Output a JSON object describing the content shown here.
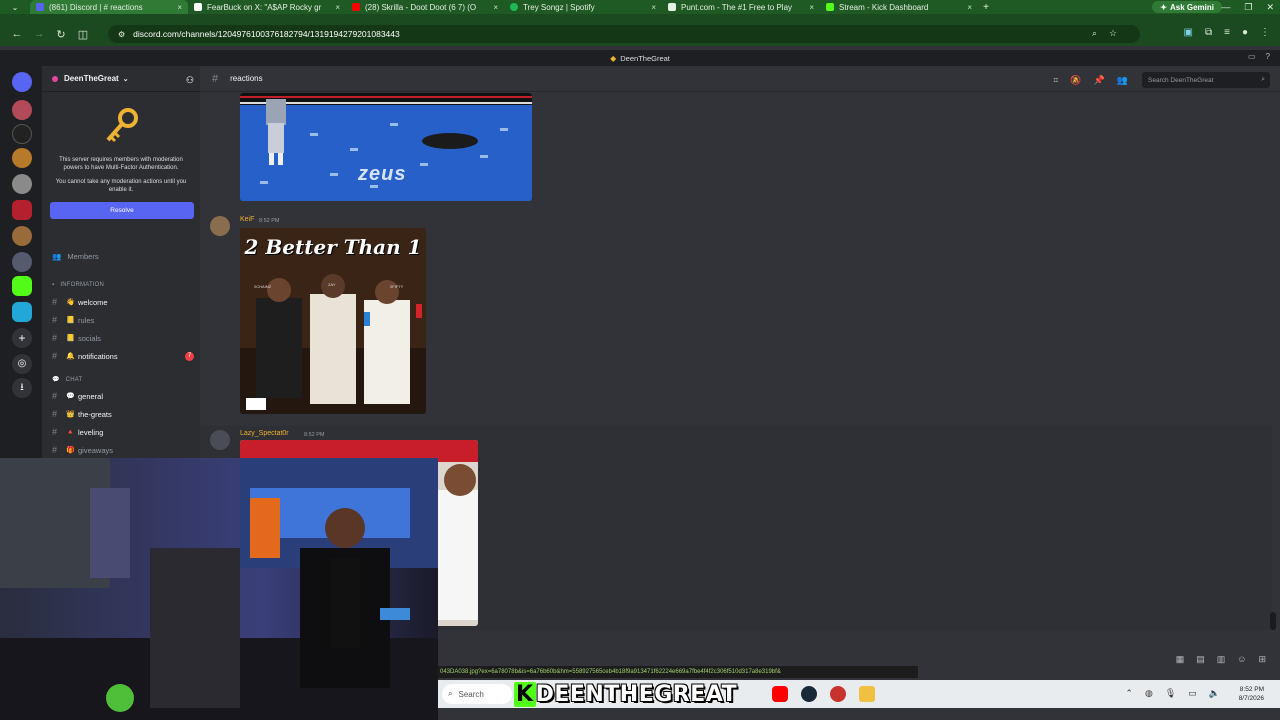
{
  "browser": {
    "tabs": [
      {
        "title": "(861) Discord | # reactions",
        "fav": "#5865f2",
        "active": true
      },
      {
        "title": "FearBuck on X: \"A$AP Rocky gr",
        "fav": "#ffffff",
        "active": false
      },
      {
        "title": "(28) Skrilla - Doot Doot (6 7) (O",
        "fav": "#ff0000",
        "active": false
      },
      {
        "title": "Trey Songz | Spotify",
        "fav": "#1db954",
        "active": false
      },
      {
        "title": "Punt.com - The #1 Free to Play",
        "fav": "#e6efe4",
        "active": false
      },
      {
        "title": "Stream - Kick Dashboard",
        "fav": "#53fc18",
        "active": false
      }
    ],
    "tab_close": "×",
    "new_tab": "+",
    "gemini_label": "Ask Gemini",
    "url": "discord.com/channels/1204976100376182794/1319194279201083443"
  },
  "discord": {
    "window_title": "DeenTheGreat",
    "server_name": "DeenTheGreat",
    "mfa_notice": "This server requires members with moderation powers to have Multi-Factor Authentication.",
    "mfa_notice_2": "You cannot take any moderation actions until you enable it.",
    "resolve_label": "Resolve",
    "members_label": "Members",
    "categories": {
      "information": "INFORMATION",
      "chat": "CHAT"
    },
    "channels": [
      {
        "emoji": "👋",
        "name": "welcome",
        "bright": true
      },
      {
        "emoji": "📒",
        "name": "rules",
        "bright": false
      },
      {
        "emoji": "📒",
        "name": "socials",
        "bright": false
      },
      {
        "emoji": "🔔",
        "name": "notifications",
        "bright": true,
        "ping": "7"
      },
      {
        "emoji": "💬",
        "name": "general",
        "bright": true
      },
      {
        "emoji": "👑",
        "name": "the-greats",
        "bright": true
      },
      {
        "emoji": "🔺",
        "name": "leveling",
        "bright": true
      },
      {
        "emoji": "🎁",
        "name": "giveaways",
        "bright": false
      }
    ],
    "channel_name": "reactions",
    "search_placeholder": "Search DeenTheGreat",
    "messages": [
      {
        "author": "KeiF",
        "time": "8:52 PM",
        "color": "#f0b232"
      },
      {
        "author": "Lazy_Spectat0r",
        "time": "8:52 PM",
        "color": "#f0b232"
      }
    ],
    "image_text": {
      "zeus": "zeus",
      "album_title": "2 Better Than 1",
      "album_names": [
        "2CHAINZ",
        "ZAY",
        "2FIFTY"
      ]
    }
  },
  "statusbar_url": "043DA038.jpg?ex=6a78078b&is=6a76b60b&hm=558927565ceb4b18f9a913471f62224e669a7fbe4f4f2c306f510d317a8e319bf&",
  "taskbar": {
    "search_label": "Search",
    "brand": {
      "k": "K",
      "rest": "DEENTHEGREAT"
    },
    "time": "8:52 PM",
    "date": "8/7/2026"
  }
}
